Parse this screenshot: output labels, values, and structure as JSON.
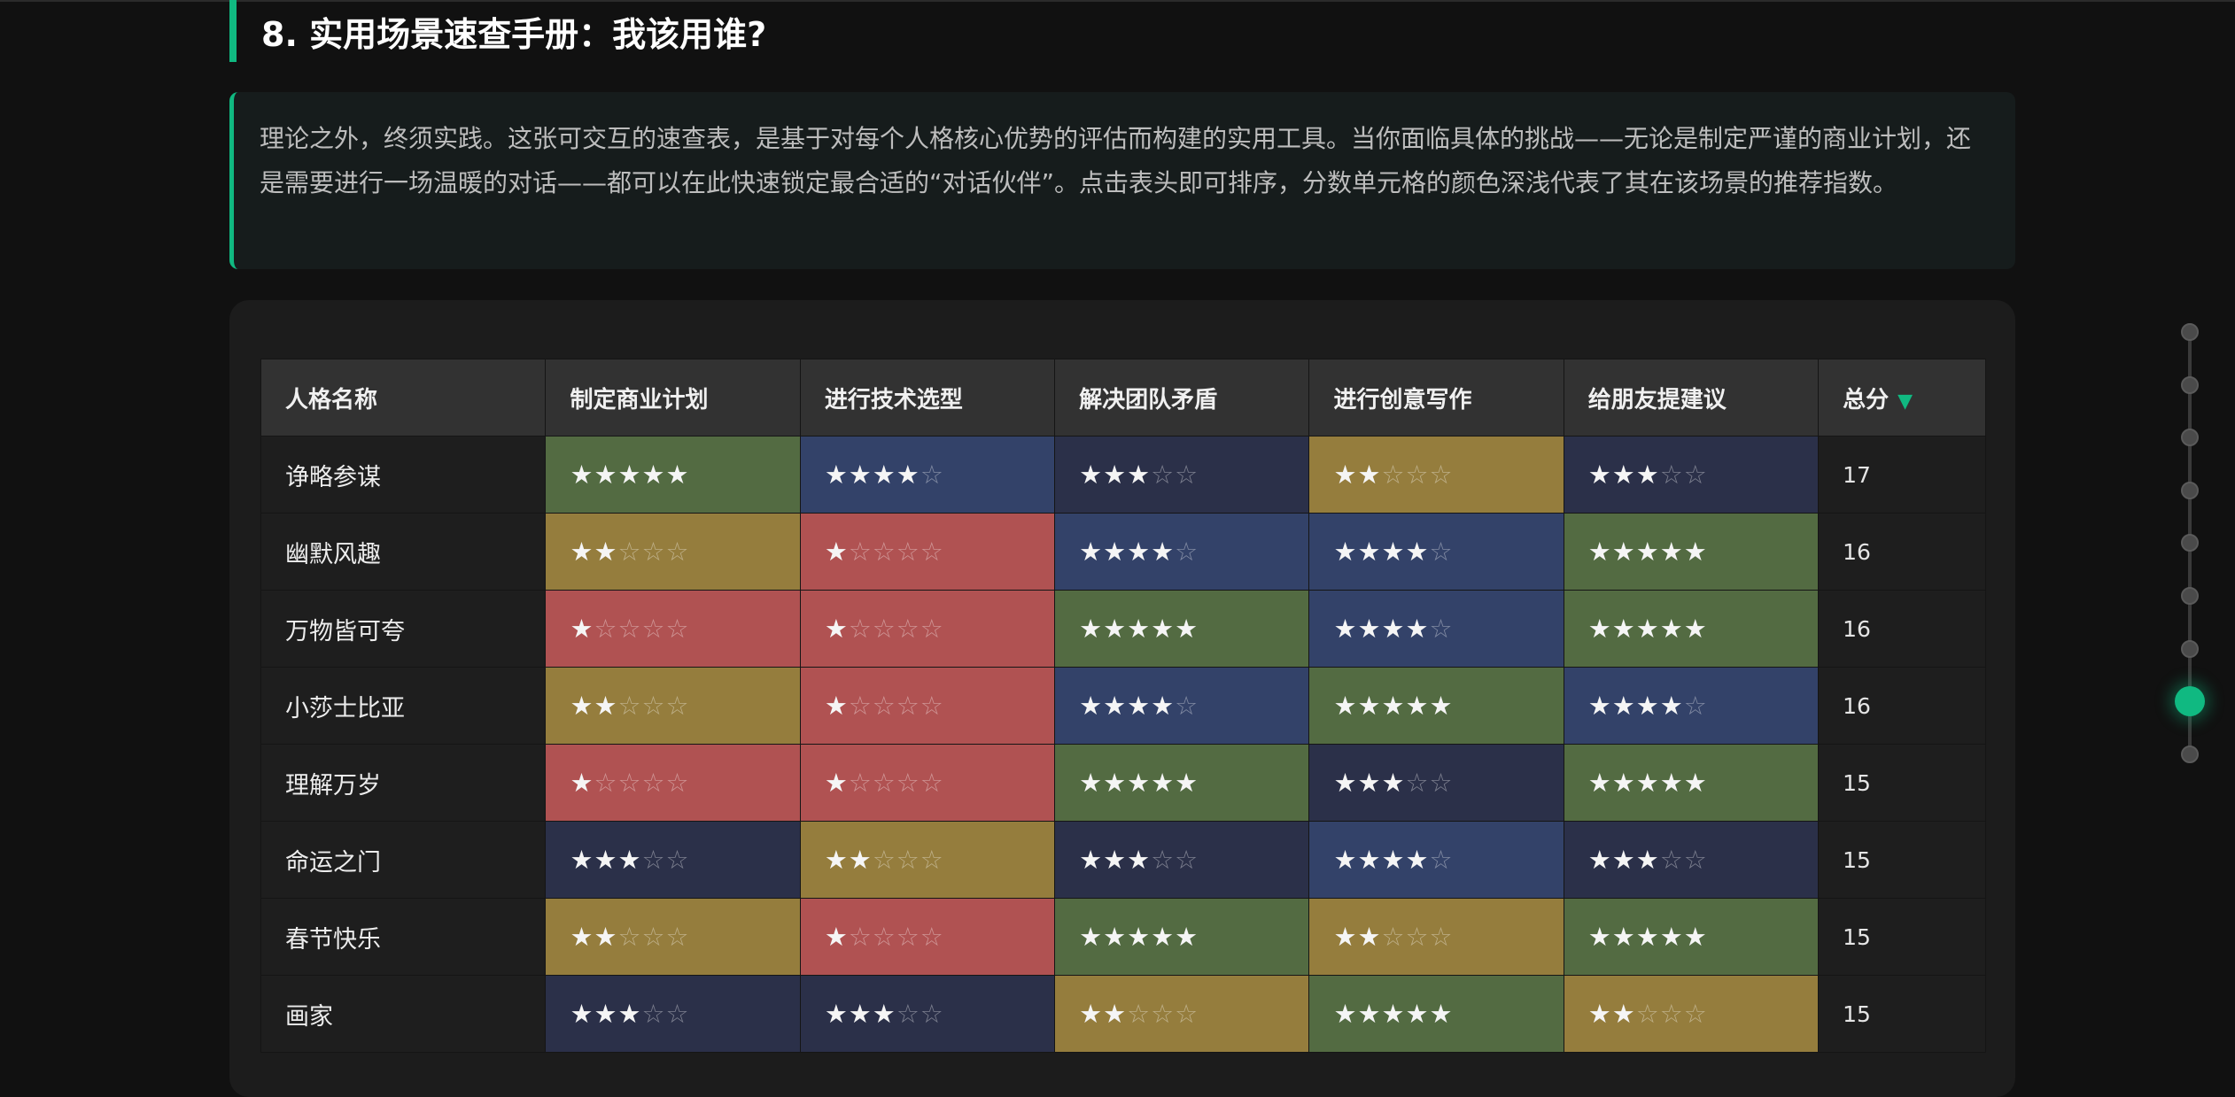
{
  "section": {
    "title": "8. 实用场景速查手册：我该用谁?"
  },
  "intro": {
    "text": "理论之外，终须实践。这张可交互的速查表，是基于对每个人格核心优势的评估而构建的实用工具。当你面临具体的挑战——无论是制定严谨的商业计划，还是需要进行一场温暖的对话——都可以在此快速锁定最合适的“对话伙伴”。点击表头即可排序，分数单元格的颜色深浅代表了其在该场景的推荐指数。"
  },
  "table": {
    "headers": {
      "name": "人格名称",
      "business": "制定商业计划",
      "tech": "进行技术选型",
      "conflict": "解决团队矛盾",
      "writing": "进行创意写作",
      "advice": "给朋友提建议",
      "total": "总分"
    },
    "sort_indicator": "▼",
    "score_colors": {
      "1": "#b05252",
      "2": "#957d3d",
      "3": "#2b3049",
      "4": "#334269",
      "5": "#536b42"
    },
    "rows": [
      {
        "name": "诤略参谋",
        "scores": [
          5,
          4,
          3,
          2,
          3
        ],
        "total": "17"
      },
      {
        "name": "幽默风趣",
        "scores": [
          2,
          1,
          4,
          4,
          5
        ],
        "total": "16"
      },
      {
        "name": "万物皆可夸",
        "scores": [
          1,
          1,
          5,
          4,
          5
        ],
        "total": "16"
      },
      {
        "name": "小莎士比亚",
        "scores": [
          2,
          1,
          4,
          5,
          4
        ],
        "total": "16"
      },
      {
        "name": "理解万岁",
        "scores": [
          1,
          1,
          5,
          3,
          5
        ],
        "total": "15"
      },
      {
        "name": "命运之门",
        "scores": [
          3,
          2,
          3,
          4,
          3
        ],
        "total": "15"
      },
      {
        "name": "春节快乐",
        "scores": [
          2,
          1,
          5,
          2,
          5
        ],
        "total": "15"
      },
      {
        "name": "画家",
        "scores": [
          3,
          3,
          2,
          5,
          2
        ],
        "total": "15"
      }
    ]
  },
  "scroll_nav": {
    "dot_count": 9,
    "active_index": 7
  }
}
